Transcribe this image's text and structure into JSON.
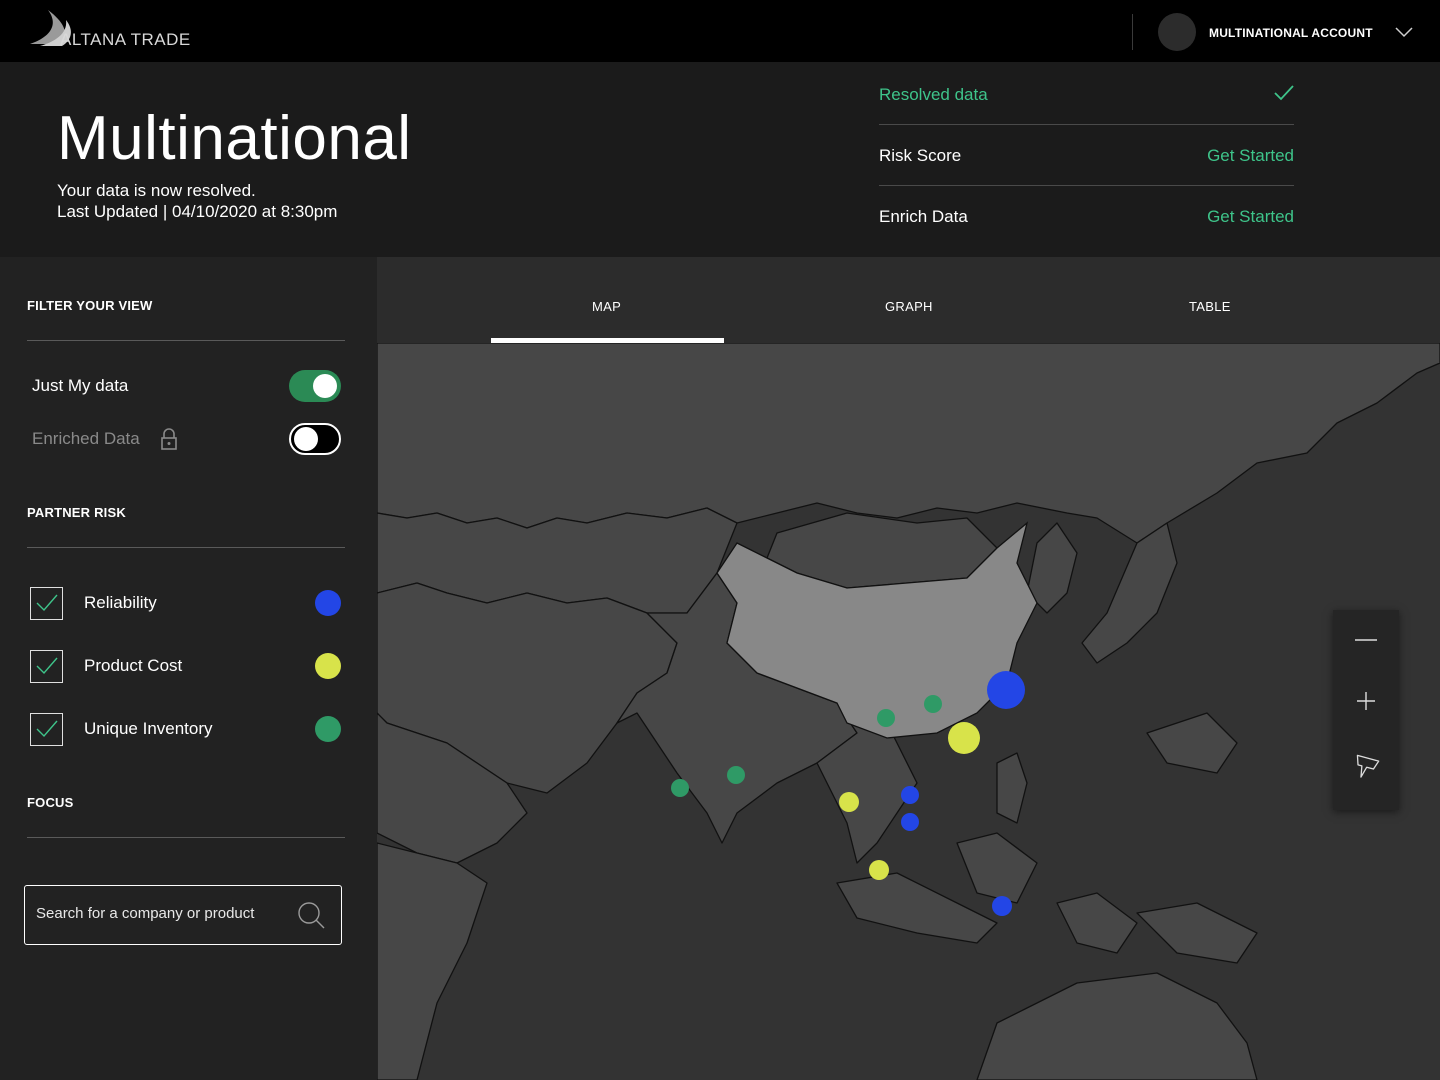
{
  "brand": {
    "name": "ALTANA TRADE"
  },
  "account": {
    "label": "MULTINATIONAL ACCOUNT"
  },
  "header": {
    "title": "Multinational",
    "subtitle": "Your data is now resolved.",
    "updated": "Last Updated | 04/10/2020 at 8:30pm"
  },
  "status": [
    {
      "label": "Resolved data",
      "value": ""
    },
    {
      "label": "Risk Score",
      "value": "Get Started"
    },
    {
      "label": "Enrich Data",
      "value": "Get Started"
    }
  ],
  "sidebar": {
    "filter_title": "FILTER YOUR VIEW",
    "toggles": [
      {
        "label": "Just My data",
        "on": true
      },
      {
        "label": "Enriched Data",
        "on": false,
        "locked": true
      }
    ],
    "risk_title": "PARTNER RISK",
    "risks": [
      {
        "label": "Reliability",
        "checked": true,
        "color": "#2346e6"
      },
      {
        "label": "Product Cost",
        "checked": true,
        "color": "#d8e34a"
      },
      {
        "label": "Unique Inventory",
        "checked": true,
        "color": "#2f9a66"
      }
    ],
    "focus_title": "FOCUS",
    "search_placeholder": "Search for a company or product"
  },
  "tabs": [
    {
      "label": "MAP",
      "active": true
    },
    {
      "label": "GRAPH",
      "active": false
    },
    {
      "label": "TABLE",
      "active": false
    }
  ],
  "colors": {
    "accent_green": "#3ec48a",
    "reliability": "#2346e6",
    "product_cost": "#d8e34a",
    "unique_inventory": "#2f9a66"
  },
  "map": {
    "region": "Asia",
    "highlighted_country": "China",
    "markers": [
      {
        "type": "reliability"
      },
      {
        "type": "product_cost"
      },
      {
        "type": "unique_inventory"
      },
      {
        "type": "unique_inventory"
      },
      {
        "type": "unique_inventory"
      },
      {
        "type": "unique_inventory"
      },
      {
        "type": "product_cost"
      },
      {
        "type": "reliability"
      },
      {
        "type": "reliability"
      },
      {
        "type": "product_cost"
      },
      {
        "type": "reliability"
      }
    ]
  },
  "zoom_controls": [
    "zoom-out-icon",
    "zoom-in-icon",
    "pin-icon"
  ]
}
